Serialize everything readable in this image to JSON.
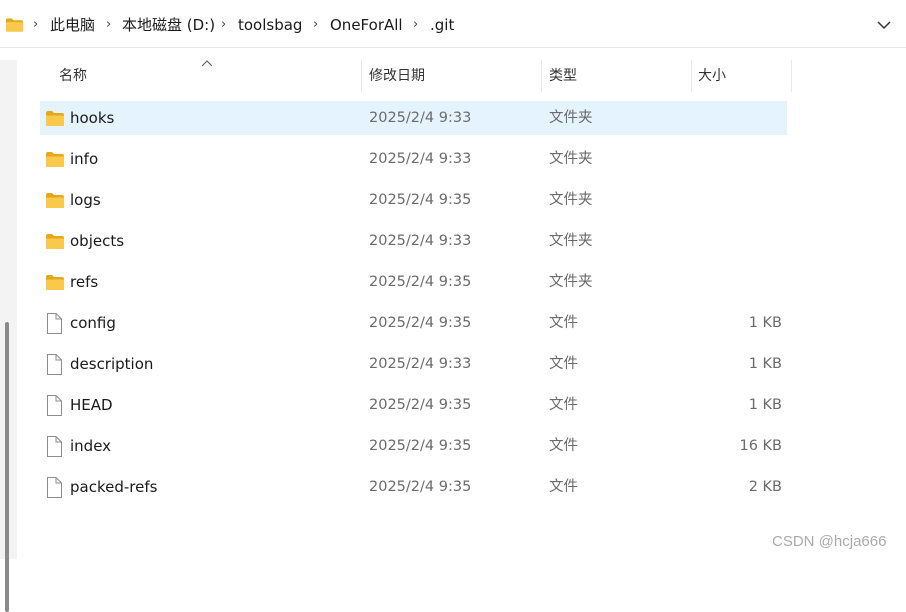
{
  "breadcrumb": {
    "items": [
      "此电脑",
      "本地磁盘 (D:)",
      "toolsbag",
      "OneForAll",
      ".git"
    ],
    "separator": "›"
  },
  "columns": {
    "name": "名称",
    "modified": "修改日期",
    "type": "类型",
    "size": "大小"
  },
  "files": [
    {
      "name": "hooks",
      "modified": "2025/2/4 9:33",
      "type": "文件夹",
      "size": "",
      "kind": "folder",
      "selected": true
    },
    {
      "name": "info",
      "modified": "2025/2/4 9:33",
      "type": "文件夹",
      "size": "",
      "kind": "folder"
    },
    {
      "name": "logs",
      "modified": "2025/2/4 9:35",
      "type": "文件夹",
      "size": "",
      "kind": "folder"
    },
    {
      "name": "objects",
      "modified": "2025/2/4 9:33",
      "type": "文件夹",
      "size": "",
      "kind": "folder"
    },
    {
      "name": "refs",
      "modified": "2025/2/4 9:35",
      "type": "文件夹",
      "size": "",
      "kind": "folder"
    },
    {
      "name": "config",
      "modified": "2025/2/4 9:35",
      "type": "文件",
      "size": "1 KB",
      "kind": "file"
    },
    {
      "name": "description",
      "modified": "2025/2/4 9:33",
      "type": "文件",
      "size": "1 KB",
      "kind": "file"
    },
    {
      "name": "HEAD",
      "modified": "2025/2/4 9:35",
      "type": "文件",
      "size": "1 KB",
      "kind": "file"
    },
    {
      "name": "index",
      "modified": "2025/2/4 9:35",
      "type": "文件",
      "size": "16 KB",
      "kind": "file"
    },
    {
      "name": "packed-refs",
      "modified": "2025/2/4 9:35",
      "type": "文件",
      "size": "2 KB",
      "kind": "file"
    }
  ],
  "watermark": "CSDN @hcja666",
  "colors": {
    "folder": "#f8c94a",
    "selected_row": "#e5f3ff"
  },
  "icons": {
    "folder": "folder-icon",
    "file": "file-icon",
    "dropdown": "chevron-down-icon",
    "sort": "sort-ascending-icon"
  }
}
